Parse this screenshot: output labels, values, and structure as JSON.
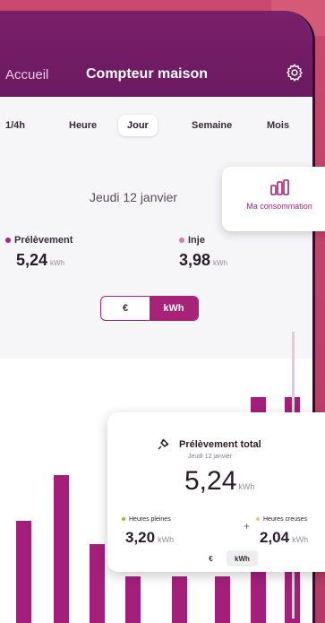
{
  "nav": {
    "back_label": "Accueil",
    "title": "Compteur maison"
  },
  "icons": {
    "settings": "gear-icon",
    "consumption": "bar-chart-icon",
    "withdrawal": "plug-icon"
  },
  "tabs": [
    {
      "label": "1/4h"
    },
    {
      "label": "Heure"
    },
    {
      "label": "Jour",
      "active": true
    },
    {
      "label": "Semaine"
    },
    {
      "label": "Mois"
    }
  ],
  "date": "Jeudi 12 janvier",
  "metrics": {
    "withdrawal": {
      "label": "Prélèvement",
      "value": "5,24",
      "unit": "kWh"
    },
    "injection": {
      "label": "Inje",
      "value": "3,98",
      "unit": "kWh"
    }
  },
  "unit_toggle": {
    "euro": "€",
    "kwh": "kWh",
    "selected": "kWh"
  },
  "floating_card": {
    "label": "Ma consommation"
  },
  "total_card": {
    "title": "Prélèvement total",
    "subtitle": "Jeudi 12 janvier",
    "value": "5,24",
    "unit": "kWh",
    "peak_label": "Heures pleines",
    "peak_value": "3,20",
    "peak_unit": "kWh",
    "offpeak_label": "Heures creuses",
    "offpeak_value": "2,04",
    "offpeak_unit": "kWh",
    "plus": "+",
    "toggle_euro": "€",
    "toggle_kwh": "kWh"
  },
  "colors": {
    "accent": "#a31f7a",
    "header": "#6b1a60"
  }
}
